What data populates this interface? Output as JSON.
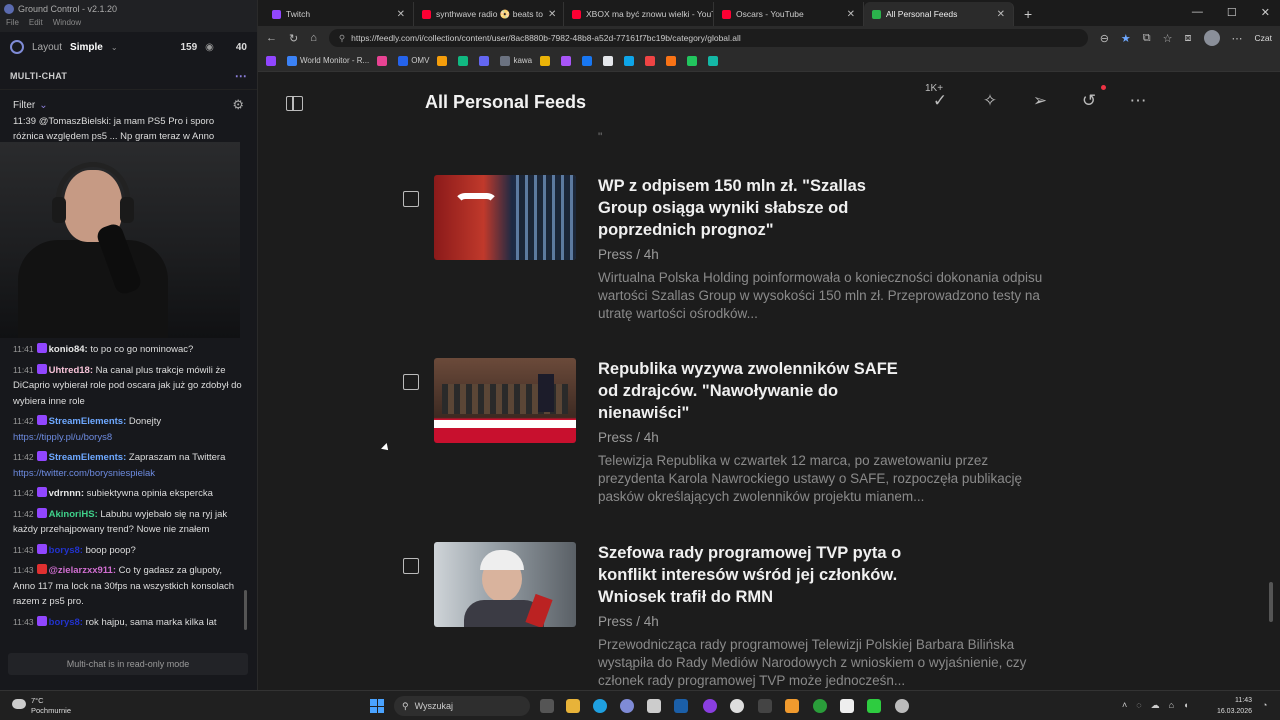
{
  "ground_control": {
    "title": "Ground Control - v2.1.20",
    "menu": [
      "File",
      "Edit",
      "Window"
    ],
    "layout_label": "Layout",
    "layout_value": "Simple",
    "viewers": "159",
    "viewers2": "40",
    "section": "MULTI-CHAT",
    "filter_label": "Filter",
    "chat_top": "11:39 @TomaszBielski: ja mam PS5 Pro i sporo różnica względem ps5 ... Np gram teraz w Anno",
    "messages": [
      {
        "time": "11:41",
        "user": "konio84:",
        "user_color": "#e8e8e8",
        "text": " to po co go nominowac?",
        "badge": "#9146ff"
      },
      {
        "time": "11:41",
        "user": "Uhtred18:",
        "user_color": "#f7c3d8",
        "text": " Na canal plus trakcje mówili że DiCaprio wybierał role pod oscara jak już go zdobył do wybiera inne role",
        "badge": "#9146ff"
      },
      {
        "time": "11:42",
        "user": "StreamElements:",
        "user_color": "#6ea8ff",
        "text": " Donejty ",
        "link": "https://tipply.pl/u/borys8",
        "badge": "#9146ff"
      },
      {
        "time": "11:42",
        "user": "StreamElements:",
        "user_color": "#6ea8ff",
        "text": " Zapraszam na Twittera ",
        "link": "https://twitter.com/borysniespielak",
        "badge": "#9146ff"
      },
      {
        "time": "11:42",
        "user": "vdrnnn:",
        "user_color": "#e8e8e8",
        "text": " subiektywna opinia eksperckа",
        "badge": "#9146ff"
      },
      {
        "time": "11:42",
        "user": "AkinoriHS:",
        "user_color": "#3fd08a",
        "text": " Labubu wyjebało się na ryj jak każdy przehajpowany trend? Nowe nie znałem",
        "badge": "#9146ff"
      },
      {
        "time": "11:43",
        "user": "borys8:",
        "user_color": "#2233cc",
        "text": " boop poop?",
        "badge": "#9146ff"
      },
      {
        "time": "11:43",
        "user": "@zielarzxx911:",
        "user_color": "#d06ed0",
        "text": " Co ty gadasz za glupoty, Anno 117 ma lock na 30fps na wszystkich konsolach razem z ps5 pro.",
        "badge": "#e03030"
      },
      {
        "time": "11:43",
        "user": "borys8:",
        "user_color": "#2233cc",
        "text": " rok hajpu, sama marka kilka lat",
        "badge": "#9146ff"
      }
    ],
    "readonly": "Multi-chat is in read-only mode"
  },
  "browser": {
    "tabs": [
      {
        "label": "Twitch",
        "color": "#9146ff",
        "active": false
      },
      {
        "label": "synthwave radio 📀 beats to",
        "color": "#ff0033",
        "active": false
      },
      {
        "label": "XBOX ma być znowu wielki - YouT",
        "color": "#ff0033",
        "active": false
      },
      {
        "label": "Oscars - YouTube",
        "color": "#ff0033",
        "active": false
      },
      {
        "label": "All Personal Feeds",
        "color": "#2bb24c",
        "active": true
      }
    ],
    "url": "https://feedly.com/i/collection/content/user/8ac8880b-7982-48b8-a52d-77161f7bc19b/category/global.all",
    "czat": "Czat",
    "bookmarks": [
      {
        "label": "",
        "color": "#9146ff"
      },
      {
        "label": "World Monitor - R...",
        "color": "#3b82f6"
      },
      {
        "label": "",
        "color": "#e84393"
      },
      {
        "label": "OMV",
        "color": "#2563eb"
      },
      {
        "label": "",
        "color": "#f59e0b"
      },
      {
        "label": "",
        "color": "#10b981"
      },
      {
        "label": "",
        "color": "#6366f1"
      },
      {
        "label": "kawa",
        "color": "#6b7280"
      },
      {
        "label": "",
        "color": "#eab308"
      },
      {
        "label": "",
        "color": "#a855f7"
      },
      {
        "label": "",
        "color": "#1877f2"
      },
      {
        "label": "",
        "color": "#e5e7eb"
      },
      {
        "label": "",
        "color": "#0ea5e9"
      },
      {
        "label": "",
        "color": "#ef4444"
      },
      {
        "label": "",
        "color": "#f97316"
      },
      {
        "label": "",
        "color": "#22c55e"
      },
      {
        "label": "",
        "color": "#14b8a6"
      }
    ]
  },
  "feedly": {
    "title": "All Personal Feeds",
    "mark_read_count": "1K+",
    "quote_mark": "\"",
    "articles": [
      {
        "title": "WP z odpisem 150 mln zł. \"Szallas Group osiąga wyniki słabsze od poprzednich prognoz\"",
        "source": "Press / 4h",
        "summary": "Wirtualna Polska Holding poinformowała o konieczności dokonania odpisu wartości Szallas Group w wysokości 150 mln zł. Przeprowadzono testy na utratę wartości ośrodków...",
        "thumb": "wp"
      },
      {
        "title": "Republika wyzywa zwolenników SAFE od zdrajców. \"Nawoływanie do nienawiści\"",
        "source": "Press / 4h",
        "summary": "Telewizja Republika w czwartek 12 marca, po zawetowaniu przez prezydenta Karola Nawrockiego ustawy o SAFE, rozpoczęła publikację pasków określających zwolenników projektu mianem...",
        "thumb": "republika"
      },
      {
        "title": "Szefowa rady programowej TVP pyta o konflikt interesów wśród jej członków. Wniosek trafił do RMN",
        "source": "Press / 4h",
        "summary": "Przewodnicząca rady programowej Telewizji Polskiej Barbara Bilińska wystąpiła do Rady Mediów Narodowych z wnioskiem o wyjaśnienie, czy członek rady programowej TVP może jednocześn...",
        "thumb": "tvp"
      }
    ]
  },
  "taskbar": {
    "temp": "7°C",
    "weather": "Pochmurnie",
    "search_placeholder": "Wyszukaj",
    "time": "11:43",
    "date": "16.03.2026"
  }
}
